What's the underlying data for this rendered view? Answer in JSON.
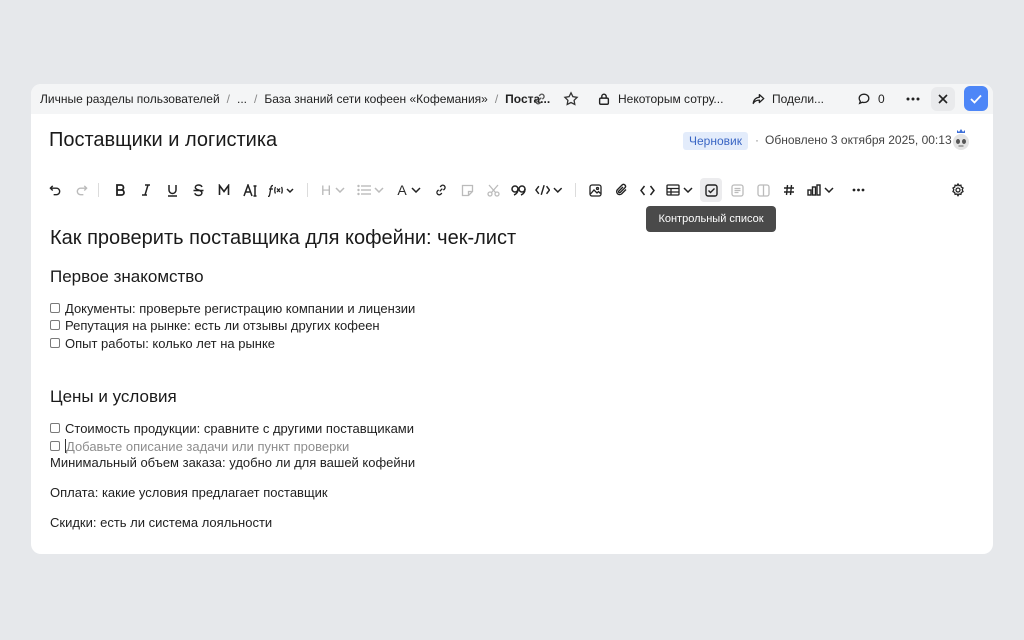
{
  "breadcrumbs": [
    {
      "label": "Личные разделы пользователей"
    },
    {
      "label": "..."
    },
    {
      "label": "База знаний сети кофеен «Кофемания»"
    },
    {
      "label": "Поста..."
    }
  ],
  "topbar": {
    "access_label": "Некоторым сотру...",
    "share_label": "Подели...",
    "comments_count": "0"
  },
  "doc": {
    "title": "Поставщики и логистика",
    "status_badge": "Черновик",
    "updated_text": "Обновлено 3 октября 2025, 00:13"
  },
  "toolbar": {
    "tooltip": "Контрольный список",
    "heading_label": "H",
    "text_label": "A"
  },
  "content": {
    "heading": "Как проверить поставщика для кофейни: чек-лист",
    "section1": {
      "title": "Первое знакомство",
      "items": [
        "Документы: проверьте регистрацию компании и лицензии",
        "Репутация на рынке: есть ли отзывы других кофеен",
        "Опыт работы: колько лет на рынке"
      ]
    },
    "section2": {
      "title": "Цены и условия",
      "items": [
        "Стоимость продукции: сравните с другими поставщиками"
      ],
      "placeholder": "Добавьте описание задачи или пункт проверки",
      "paragraphs": [
        "Минимальный объем заказа: удобно ли для вашей кофейни",
        "Оплата: какие условия предлагает поставщик",
        "Скидки: есть ли система лояльности"
      ]
    }
  },
  "colors": {
    "accent": "#4d86f7",
    "badge_bg": "#e3ecfb",
    "badge_text": "#3a66c4",
    "tooltip_bg": "#4a4a4a"
  }
}
